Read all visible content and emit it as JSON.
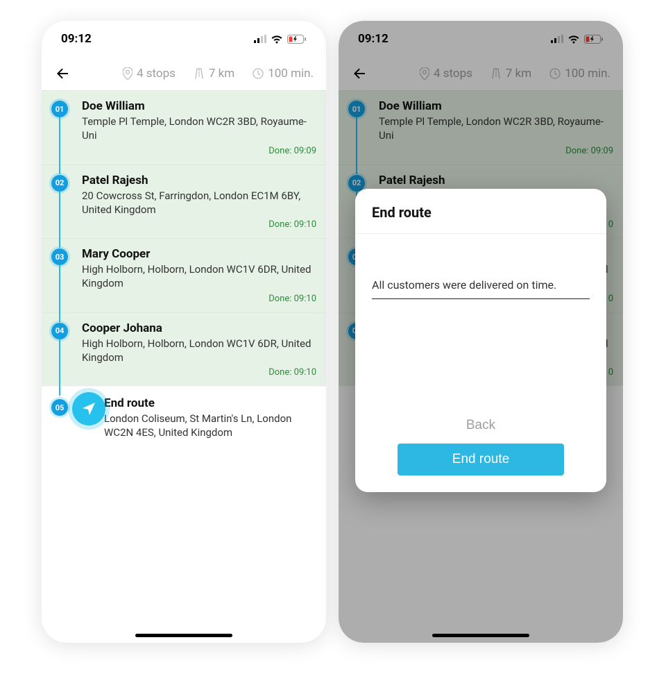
{
  "status": {
    "time": "09:12"
  },
  "header": {
    "stops": "4 stops",
    "distance": "7 km",
    "duration": "100 min."
  },
  "stops": [
    {
      "num": "01",
      "name": "Doe William",
      "address": "Temple Pl Temple, London WC2R 3BD, Royaume-Uni",
      "done": "Done: 09:09"
    },
    {
      "num": "02",
      "name": "Patel Rajesh",
      "address": "20 Cowcross St, Farringdon, London EC1M 6BY, United Kingdom",
      "done": "Done: 09:10"
    },
    {
      "num": "03",
      "name": "Mary Cooper",
      "address": "High Holborn, Holborn, London WC1V 6DR, United Kingdom",
      "done": "Done: 09:10"
    },
    {
      "num": "04",
      "name": "Cooper Johana",
      "address": "High Holborn, Holborn, London WC1V 6DR, United Kingdom",
      "done": "Done: 09:10"
    }
  ],
  "end_stop": {
    "num": "05",
    "title": "End route",
    "address": "London Coliseum, St Martin's Ln, London WC2N 4ES, United Kingdom"
  },
  "modal": {
    "title": "End route",
    "note": "All customers were delivered on time.",
    "back": "Back",
    "confirm": "End route"
  },
  "colors": {
    "accent": "#26c1ec",
    "done_bg": "#e7f2e6",
    "done_text": "#2e8b3e"
  }
}
